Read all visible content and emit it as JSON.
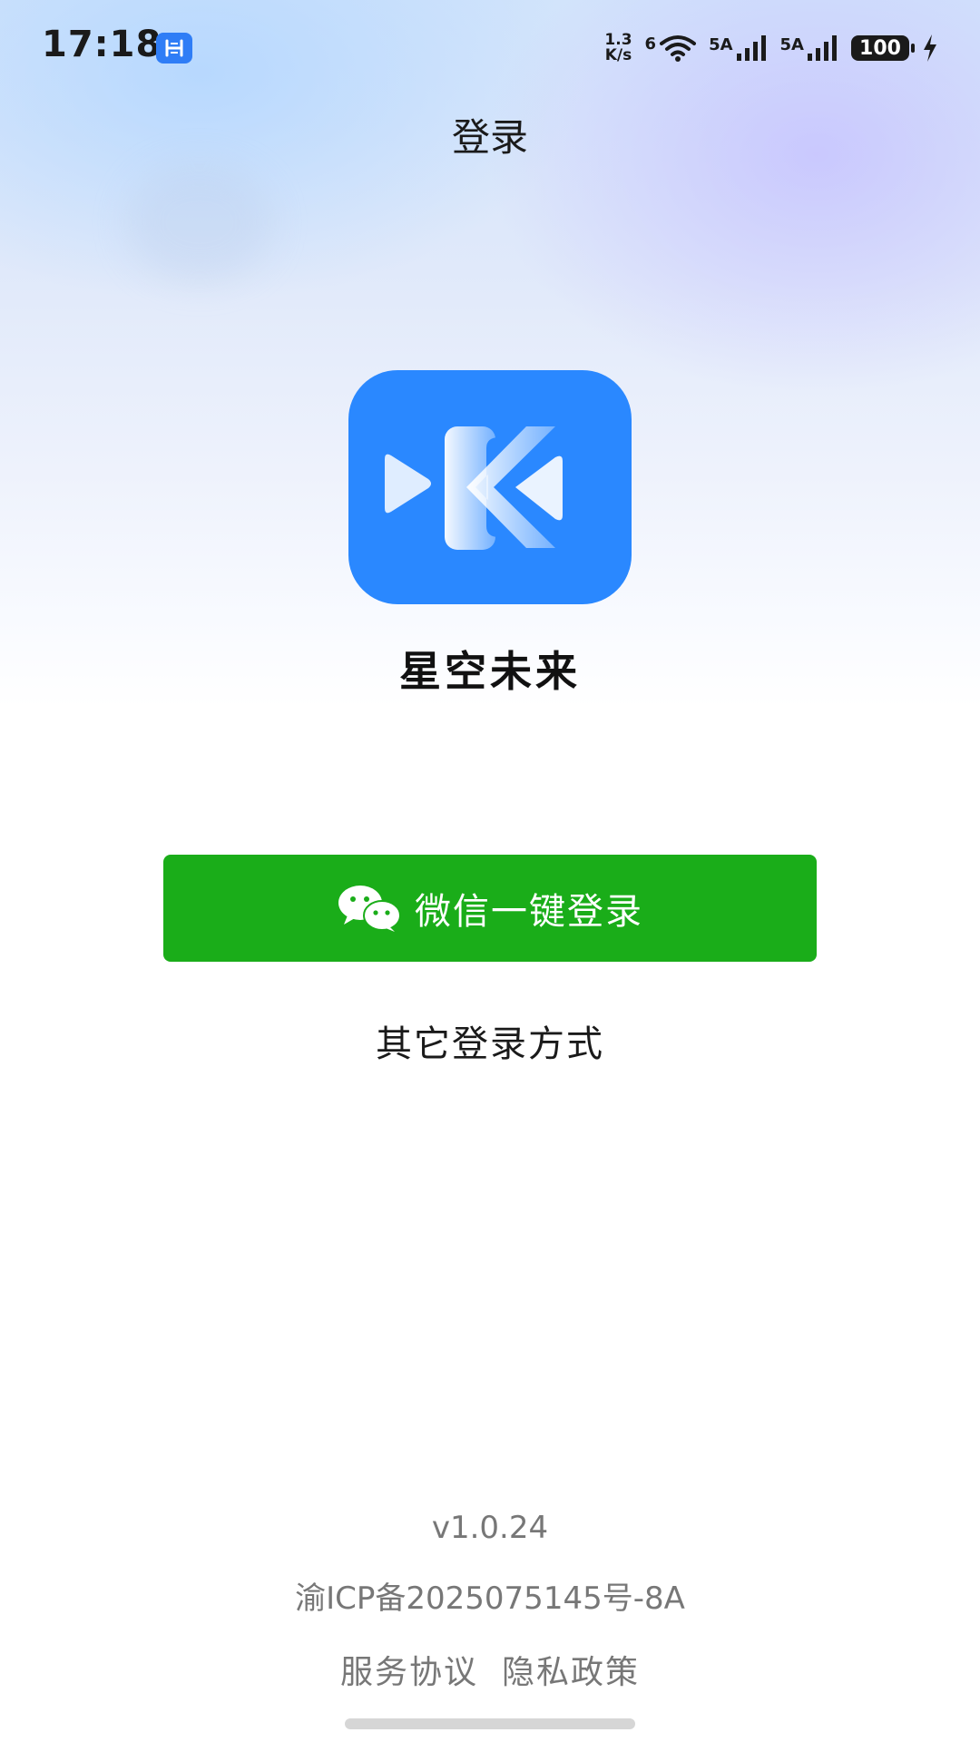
{
  "status_bar": {
    "time": "17:18",
    "net_speed_value": "1.3",
    "net_speed_unit": "K/s",
    "wifi_label": "6",
    "sim1_label": "5A",
    "sim2_label": "5A",
    "battery": "100"
  },
  "header": {
    "title": "登录"
  },
  "app": {
    "name": "星空未来",
    "brand_color": "#2a88ff"
  },
  "login": {
    "wechat_label": "微信一键登录",
    "wechat_color": "#1aad19",
    "other_label": "其它登录方式"
  },
  "footer": {
    "version": "v1.0.24",
    "icp": "渝ICP备2025075145号-8A",
    "terms_label": "服务协议",
    "privacy_label": "隐私政策"
  }
}
